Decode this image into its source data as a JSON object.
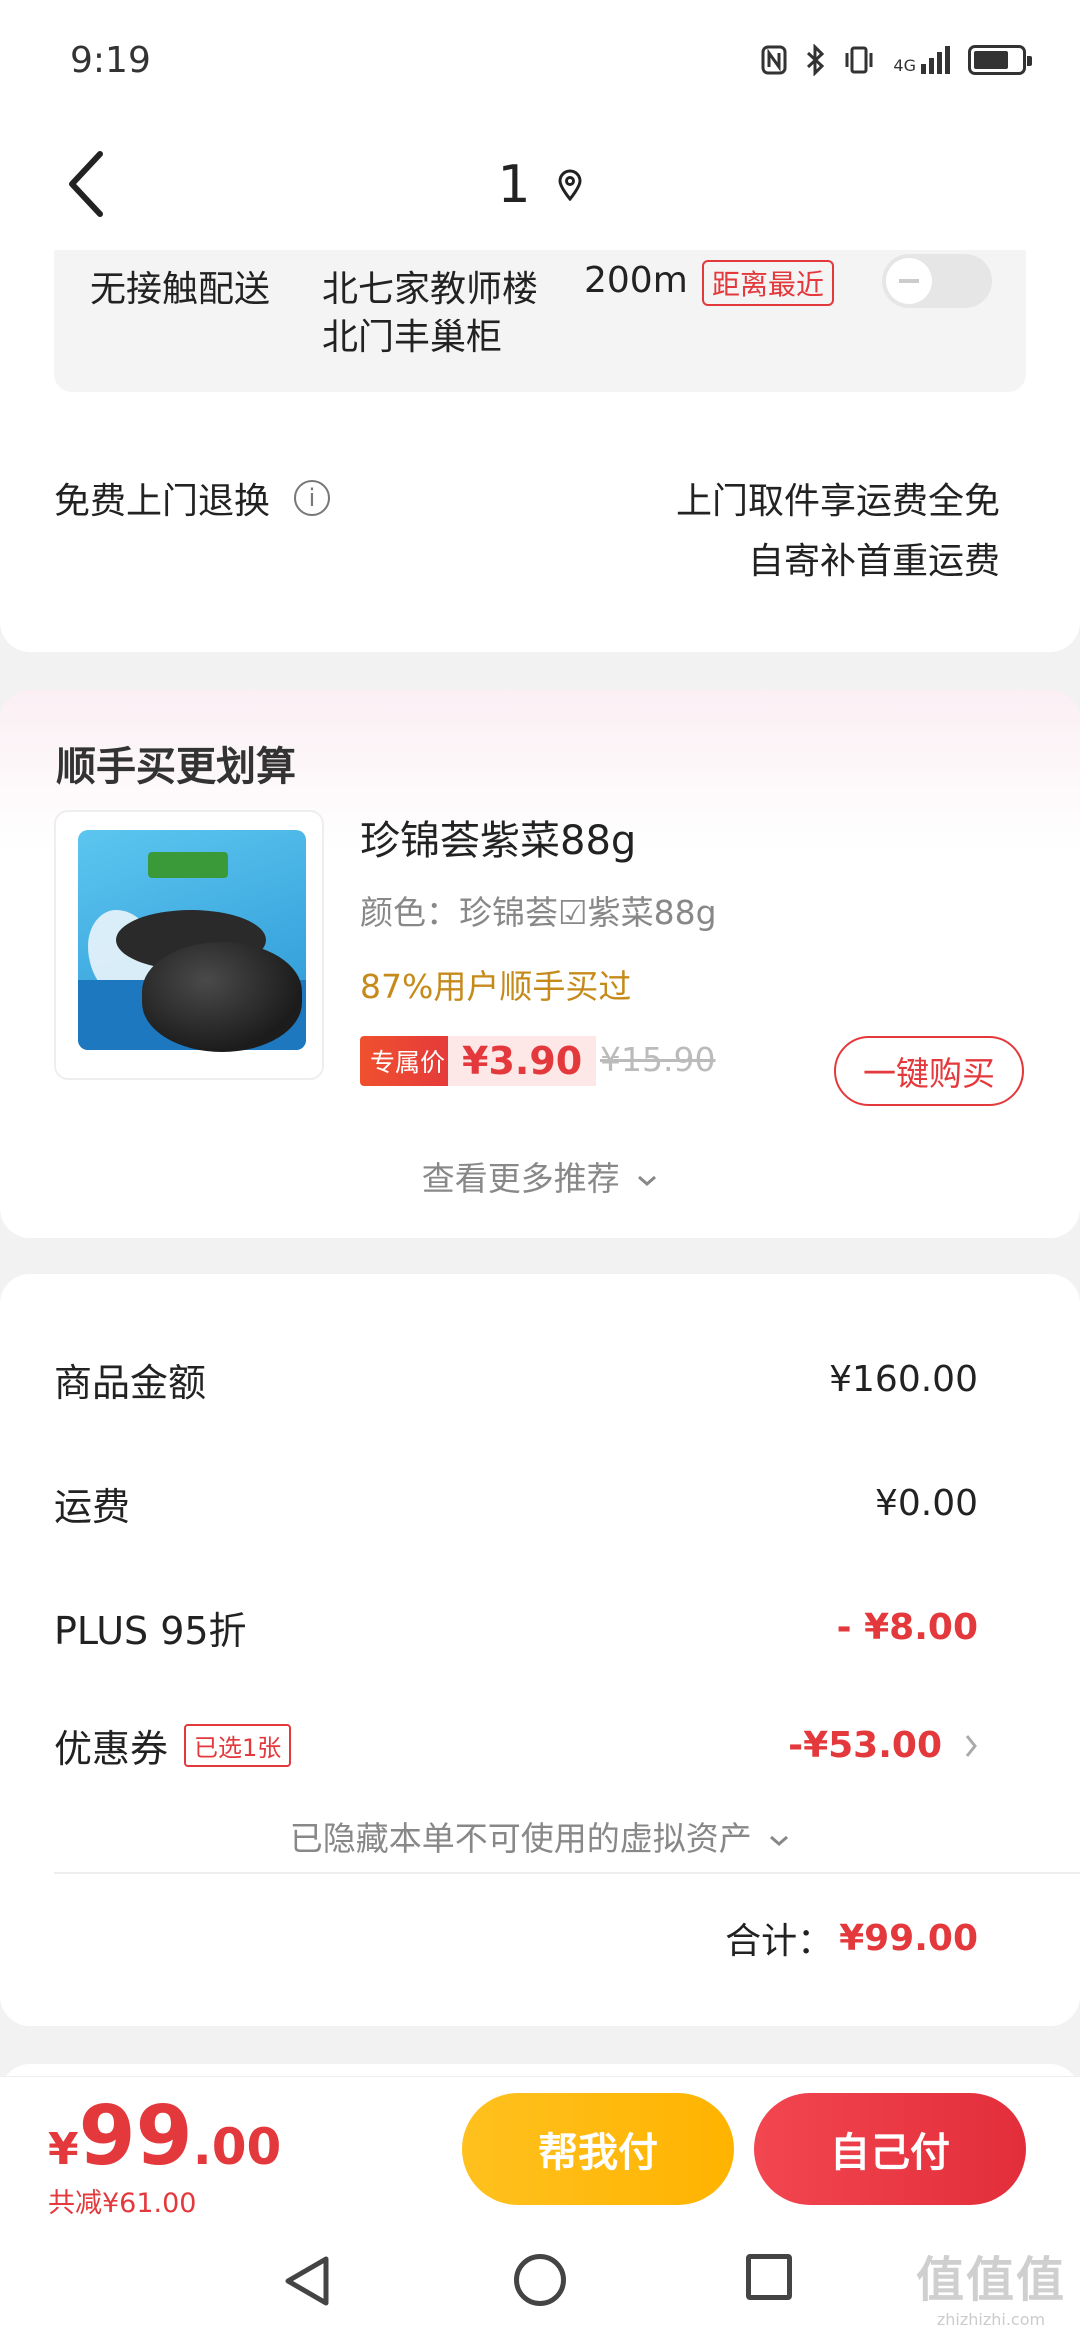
{
  "status_bar": {
    "time": "9:19",
    "icons": [
      "nfc-icon",
      "bluetooth-icon",
      "vibrate-icon",
      "signal-4g-icon",
      "battery-icon"
    ],
    "network_label": "4G"
  },
  "header": {
    "title": "1"
  },
  "delivery": {
    "label": "无接触配送",
    "location_name": "北七家教师楼",
    "location_sub": "北门丰巢柜",
    "distance": "200m",
    "nearest_tag": "距离最近",
    "toggle_on": false
  },
  "returns": {
    "label": "免费上门退换",
    "line1": "上门取件享运费全免",
    "line2": "自寄补首重运费"
  },
  "recommend": {
    "title": "顺手买更划算",
    "product": {
      "name": "珍锦荟紫菜88g",
      "spec": "颜色：珍锦荟☑紫菜88g",
      "social_proof": "87%用户顺手买过",
      "price_tag": "专属价",
      "price": "¥3.90",
      "original_price": "¥15.90",
      "buy_button": "一键购买"
    },
    "more_label": "查看更多推荐"
  },
  "summary": {
    "rows": [
      {
        "label": "商品金额",
        "value": "¥160.00"
      },
      {
        "label": "运费",
        "value": "¥0.00"
      },
      {
        "label": "PLUS 95折",
        "value": "- ¥8.00"
      },
      {
        "label": "优惠券",
        "value": "-¥53.00"
      }
    ],
    "coupon_tag": "已选1张",
    "hidden_assets": "已隐藏本单不可使用的虚拟资产",
    "total_label": "合计：",
    "total_value": "¥99.00"
  },
  "bottom": {
    "yen": "¥",
    "price_int": "99",
    "price_dec": ".00",
    "saved": "共减¥61.00",
    "help_pay": "帮我付",
    "self_pay": "自己付"
  },
  "watermark": {
    "logo": "值值值",
    "domain": "zhizhizhi.com"
  },
  "colors": {
    "accent_red": "#e4393c",
    "help_yellow": "#ffb300",
    "social_gold": "#c58a1a"
  }
}
